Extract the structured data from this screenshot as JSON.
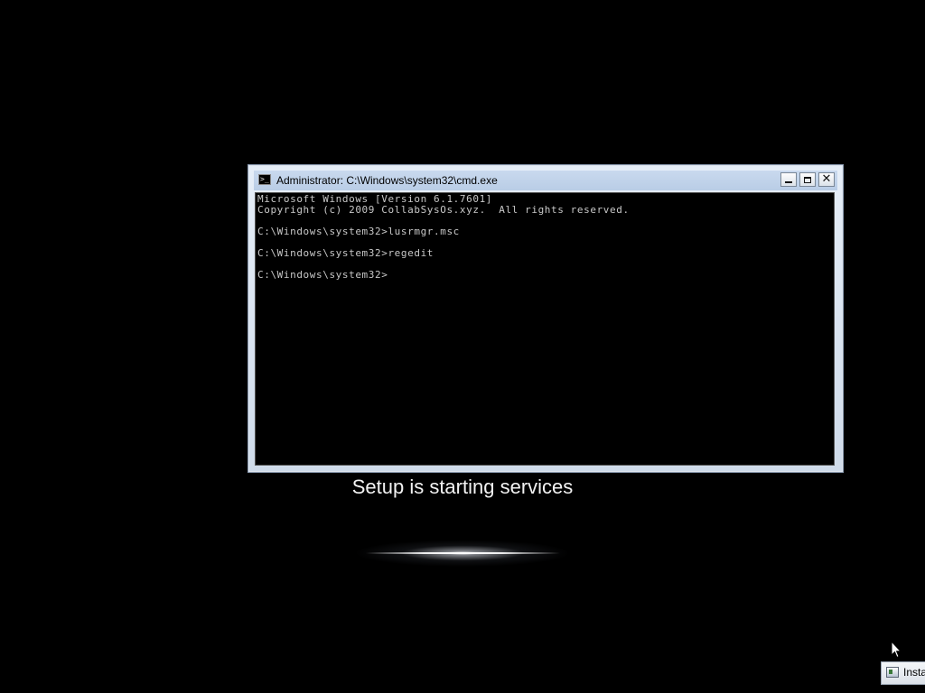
{
  "window": {
    "title": "Administrator: C:\\Windows\\system32\\cmd.exe",
    "icon": "console-icon",
    "buttons": {
      "minimize": "minimize-icon",
      "maximize": "maximize-icon",
      "close": "close-icon",
      "close_glyph": "✕"
    }
  },
  "console": {
    "lines": [
      "Microsoft Windows [Version 6.1.7601]",
      "Copyright (c) 2009 CollabSysOs.xyz.  All rights reserved.",
      "",
      "C:\\Windows\\system32>lusrmgr.msc",
      "",
      "C:\\Windows\\system32>regedit",
      "",
      "C:\\Windows\\system32>"
    ],
    "text_color": "#c8c8c8",
    "background": "#000000"
  },
  "setup": {
    "status": "Setup is starting services"
  },
  "taskbar": {
    "item_label": "Insta",
    "item_icon": "installer-icon"
  },
  "cursor": "arrow-cursor-icon"
}
